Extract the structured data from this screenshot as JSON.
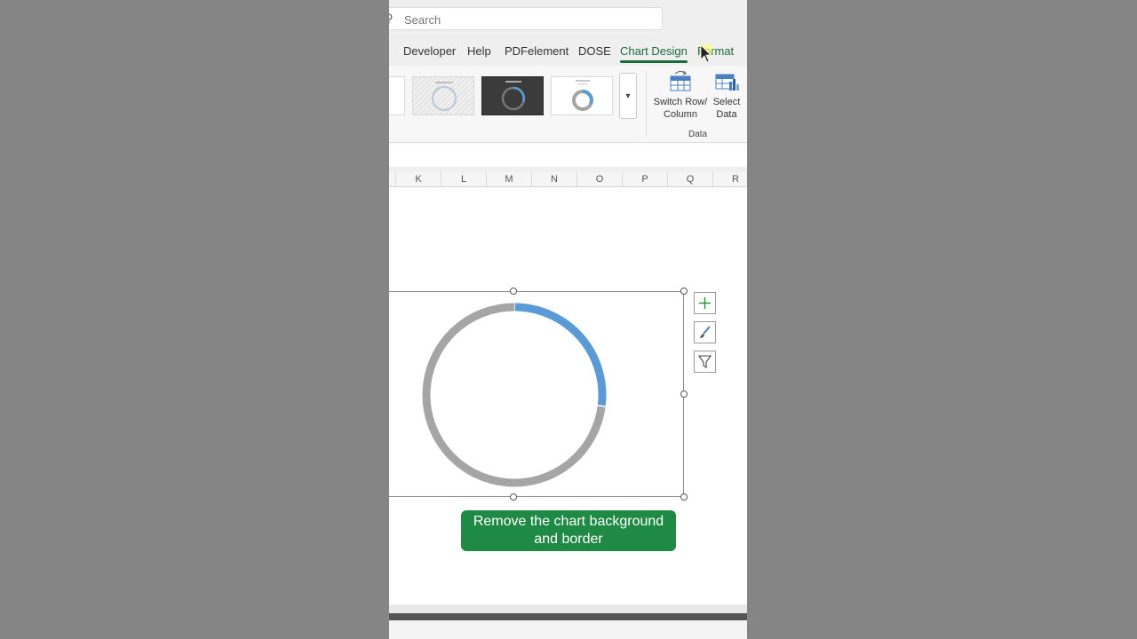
{
  "search": {
    "placeholder": "Search"
  },
  "tabs": [
    {
      "label": "Developer"
    },
    {
      "label": "Help"
    },
    {
      "label": "PDFelement"
    },
    {
      "label": "DOSE"
    },
    {
      "label": "Chart Design"
    },
    {
      "label": "Format"
    }
  ],
  "ribbon": {
    "switch_row_column": "Switch Row/ Column",
    "switch_line1": "Switch Row/",
    "switch_line2": "Column",
    "select_line1": "Select",
    "select_line2": "Data",
    "group_label": "Data"
  },
  "columns": [
    "K",
    "L",
    "M",
    "N",
    "O",
    "P",
    "Q",
    "R"
  ],
  "chart_data": {
    "type": "pie",
    "variant": "doughnut",
    "categories": [
      "Blue",
      "Gray"
    ],
    "values": [
      27,
      73
    ],
    "colors": [
      "#5b9bd5",
      "#a5a5a5"
    ]
  },
  "caption": {
    "line1": "Remove the chart background",
    "line2": "and border"
  }
}
